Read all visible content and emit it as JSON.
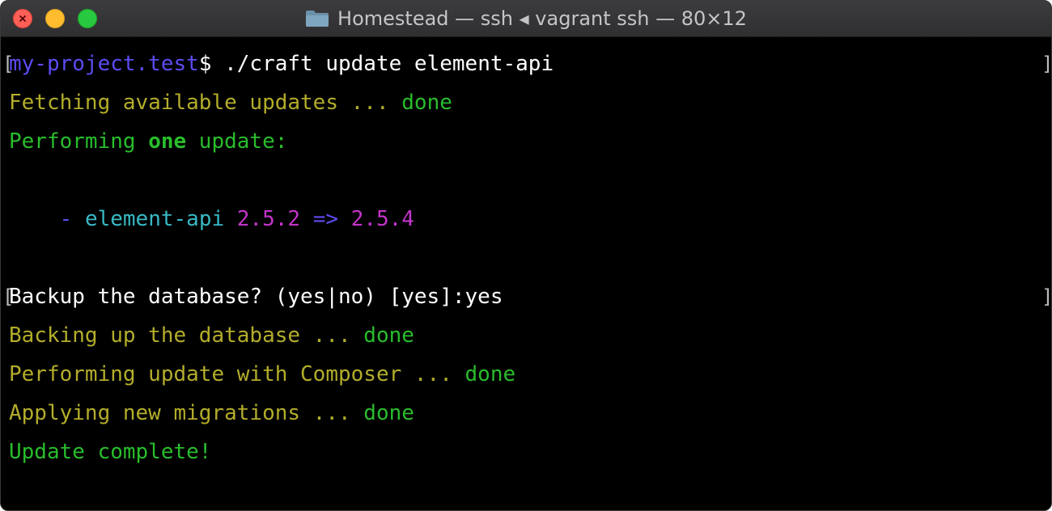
{
  "window": {
    "title": "Homestead — ssh ◂ vagrant ssh — 80×12",
    "folder_icon": "folder-icon",
    "colors": {
      "close": "#ff5f57",
      "minimize": "#febc2e",
      "maximize": "#28c840"
    }
  },
  "terminal": {
    "bracket_open": "[",
    "bracket_close": "]",
    "line1": {
      "prompt_host": "my-project.test",
      "prompt_symbol": "$ ",
      "command": "./craft update element-api"
    },
    "line2": {
      "text": "Fetching available updates ... ",
      "status": "done"
    },
    "line3": {
      "pre": "Performing ",
      "bold": "one",
      "post": " update:"
    },
    "line4": {
      "indent": "    ",
      "dash": "- ",
      "package": "element-api",
      "from": "2.5.2",
      "arrow": "=>",
      "to": "2.5.4"
    },
    "line5": {
      "question": "Backup the database? (yes|no) [yes]:",
      "answer": "yes"
    },
    "line6": {
      "text": "Backing up the database ... ",
      "status": "done"
    },
    "line7": {
      "text": "Performing update with Composer ... ",
      "status": "done"
    },
    "line8": {
      "text": "Applying new migrations ... ",
      "status": "done"
    },
    "line9": {
      "text": "Update complete!"
    }
  },
  "colors": {
    "prompt": "#5b4cf0",
    "yellow": "#b3ad2a",
    "green": "#29bd2c",
    "cyan": "#38b9c4",
    "magenta": "#c234c9",
    "background": "#000000"
  }
}
